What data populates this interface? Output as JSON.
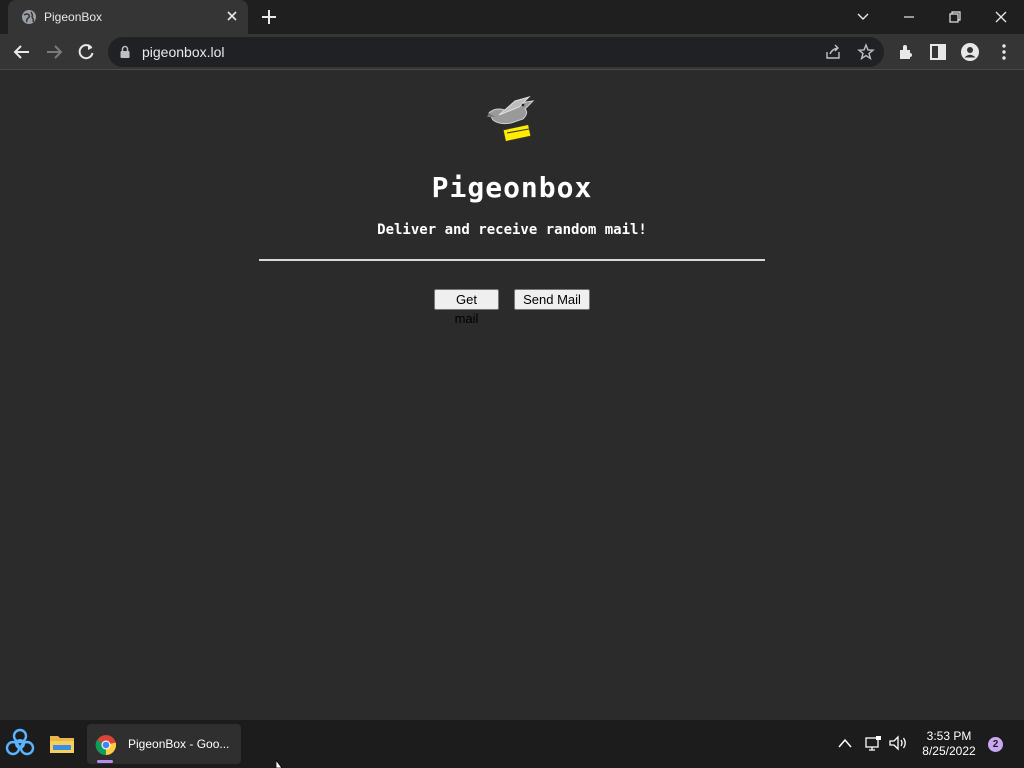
{
  "browser": {
    "tab_title": "PigeonBox",
    "url": "pigeonbox.lol"
  },
  "page": {
    "title": "Pigeonbox",
    "subtitle": "Deliver and receive random mail!",
    "get_mail_label": "Get mail",
    "send_mail_label": "Send Mail"
  },
  "taskbar": {
    "app_label": "PigeonBox - Goo...",
    "time": "3:53 PM",
    "date": "8/25/2022",
    "notification_count": "2"
  },
  "colors": {
    "page_background": "#2b2b2b",
    "tab_strip": "#1f1f1f",
    "toolbar": "#353535",
    "taskbar": "#1c1c1c",
    "accent": "#b68cf0"
  }
}
